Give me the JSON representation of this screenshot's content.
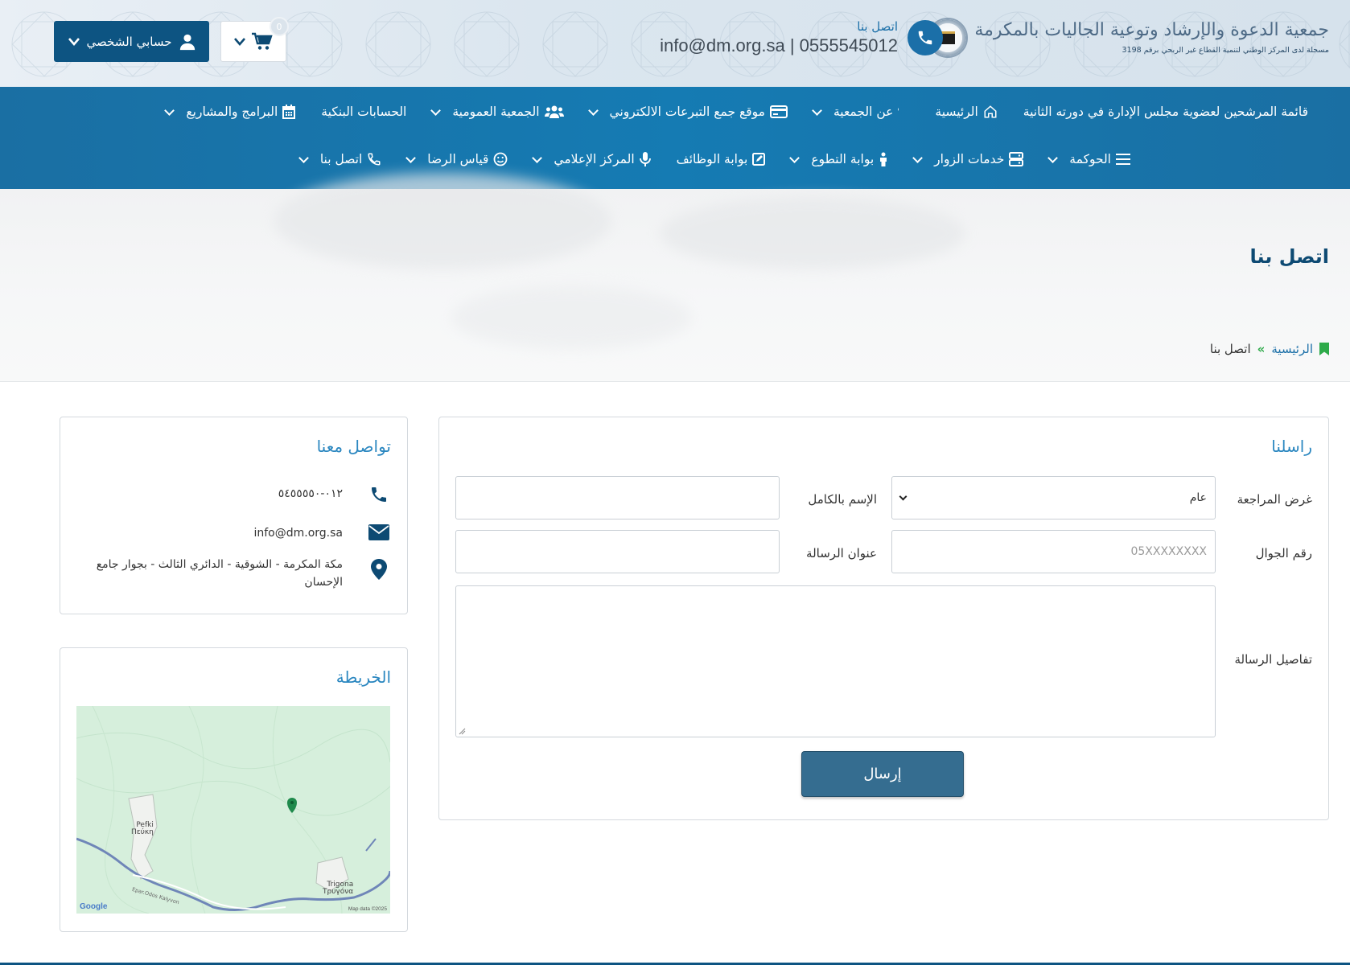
{
  "header": {
    "logo_title": "جمعية الدعوة والإرشاد وتوعية الجاليات بالمكرمة",
    "logo_subtitle": "مسجلة لدى المركز الوطني لتنمية القطاع غير الربحي برقم 3198",
    "contact_label": "اتصل بنا",
    "contact_value": "info@dm.org.sa | 0555545012",
    "account_label": "حسابي الشخصي",
    "cart_count": "0"
  },
  "nav": {
    "row1": [
      {
        "label": "قائمة المرشحين لعضوية مجلس الإدارة في دورته الثانية",
        "icon": "none",
        "has_dropdown": false
      },
      {
        "label": "الرئيسية",
        "icon": "home-icon",
        "has_dropdown": false
      },
      {
        "label": "عن الجمعية",
        "icon": "question-icon",
        "has_dropdown": true
      },
      {
        "label": "موقع جمع التبرعات الالكتروني",
        "icon": "credit-card-icon",
        "has_dropdown": true
      },
      {
        "label": "الجمعية العمومية",
        "icon": "users-icon",
        "has_dropdown": true
      },
      {
        "label": "الحسابات البنكية",
        "icon": "none",
        "has_dropdown": false
      },
      {
        "label": "البرامج والمشاريع",
        "icon": "calendar-icon",
        "has_dropdown": true
      }
    ],
    "row2": [
      {
        "label": "الحوكمة",
        "icon": "menu-icon",
        "has_dropdown": true
      },
      {
        "label": "خدمات الزوار",
        "icon": "server-icon",
        "has_dropdown": true
      },
      {
        "label": "بوابة التطوع",
        "icon": "person-icon",
        "has_dropdown": true
      },
      {
        "label": "بوابة الوظائف",
        "icon": "edit-icon",
        "has_dropdown": false
      },
      {
        "label": "المركز الإعلامي",
        "icon": "microphone-icon",
        "has_dropdown": true
      },
      {
        "label": "قياس الرضا",
        "icon": "smile-icon",
        "has_dropdown": true
      },
      {
        "label": "اتصل بنا",
        "icon": "phone-icon",
        "has_dropdown": true
      }
    ]
  },
  "page": {
    "title": "اتصل بنا",
    "breadcrumb_home": "الرئيسية",
    "breadcrumb_sep": "»",
    "breadcrumb_current": "اتصل بنا"
  },
  "form": {
    "title": "راسلنا",
    "purpose_label": "غرض المراجعة",
    "purpose_value": "عام",
    "fullname_label": "الإسم بالكامل",
    "fullname_value": "",
    "mobile_label": "رقم الجوال",
    "mobile_placeholder": "05XXXXXXXX",
    "subject_label": "عنوان الرسالة",
    "subject_value": "",
    "details_label": "تفاصيل الرسالة",
    "details_value": "",
    "submit_label": "إرسال"
  },
  "info": {
    "title": "تواصل معنا",
    "phone": "٠١٢-٥٤٥٥٥٥٠",
    "email": "info@dm.org.sa",
    "address": "مكة المكرمة - الشوقية - الدائري الثالث - بجوار جامع الإحسان"
  },
  "map": {
    "title": "الخريطة",
    "label_pefki": "Pefki\nΠεύκη",
    "label_trigona": "Trigona\nΤρυγόνα",
    "google_mark": "Google",
    "map_data": "Map data ©2025",
    "road_label": "Epar.Odos Kalyvon"
  },
  "colors": {
    "nav_blue": "#1a6fa3",
    "dark_blue": "#0d5482",
    "accent_green": "#2eaa4a",
    "submit_blue": "#356d90"
  }
}
